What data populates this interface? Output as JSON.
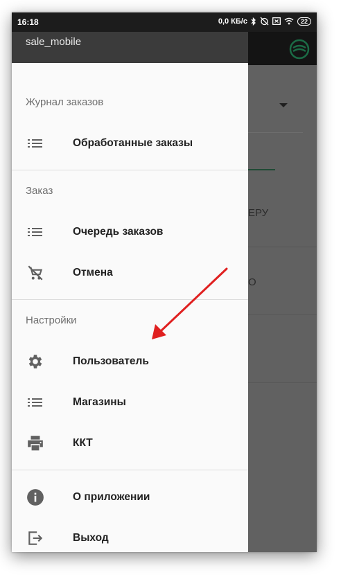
{
  "statusbar": {
    "time": "16:18",
    "network_speed": "0,0 КБ/с",
    "battery": "22",
    "icons": [
      "bluetooth-icon",
      "alarm-off-icon",
      "sim-icon",
      "wifi-icon",
      "battery-icon"
    ]
  },
  "background_app": {
    "text_fragment_1": "ЕРУ",
    "text_fragment_2": "О",
    "accent_color": "#1b6b45"
  },
  "drawer": {
    "user_name": "sale_mobile",
    "sections": [
      {
        "title": "Журнал заказов",
        "items": [
          {
            "label": "Обработанные заказы",
            "icon": "list-icon"
          }
        ]
      },
      {
        "title": "Заказ",
        "items": [
          {
            "label": "Очередь заказов",
            "icon": "list-icon"
          },
          {
            "label": "Отмена",
            "icon": "cart-off-icon"
          }
        ]
      },
      {
        "title": "Настройки",
        "items": [
          {
            "label": "Пользователь",
            "icon": "gear-icon"
          },
          {
            "label": "Магазины",
            "icon": "list-icon"
          },
          {
            "label": "ККТ",
            "icon": "printer-icon"
          }
        ]
      },
      {
        "title": "",
        "items": [
          {
            "label": "О приложении",
            "icon": "info-icon"
          },
          {
            "label": "Выход",
            "icon": "exit-icon"
          }
        ]
      }
    ]
  },
  "annotation": {
    "arrow_color": "#e02020",
    "points_to": "Пользователь"
  }
}
